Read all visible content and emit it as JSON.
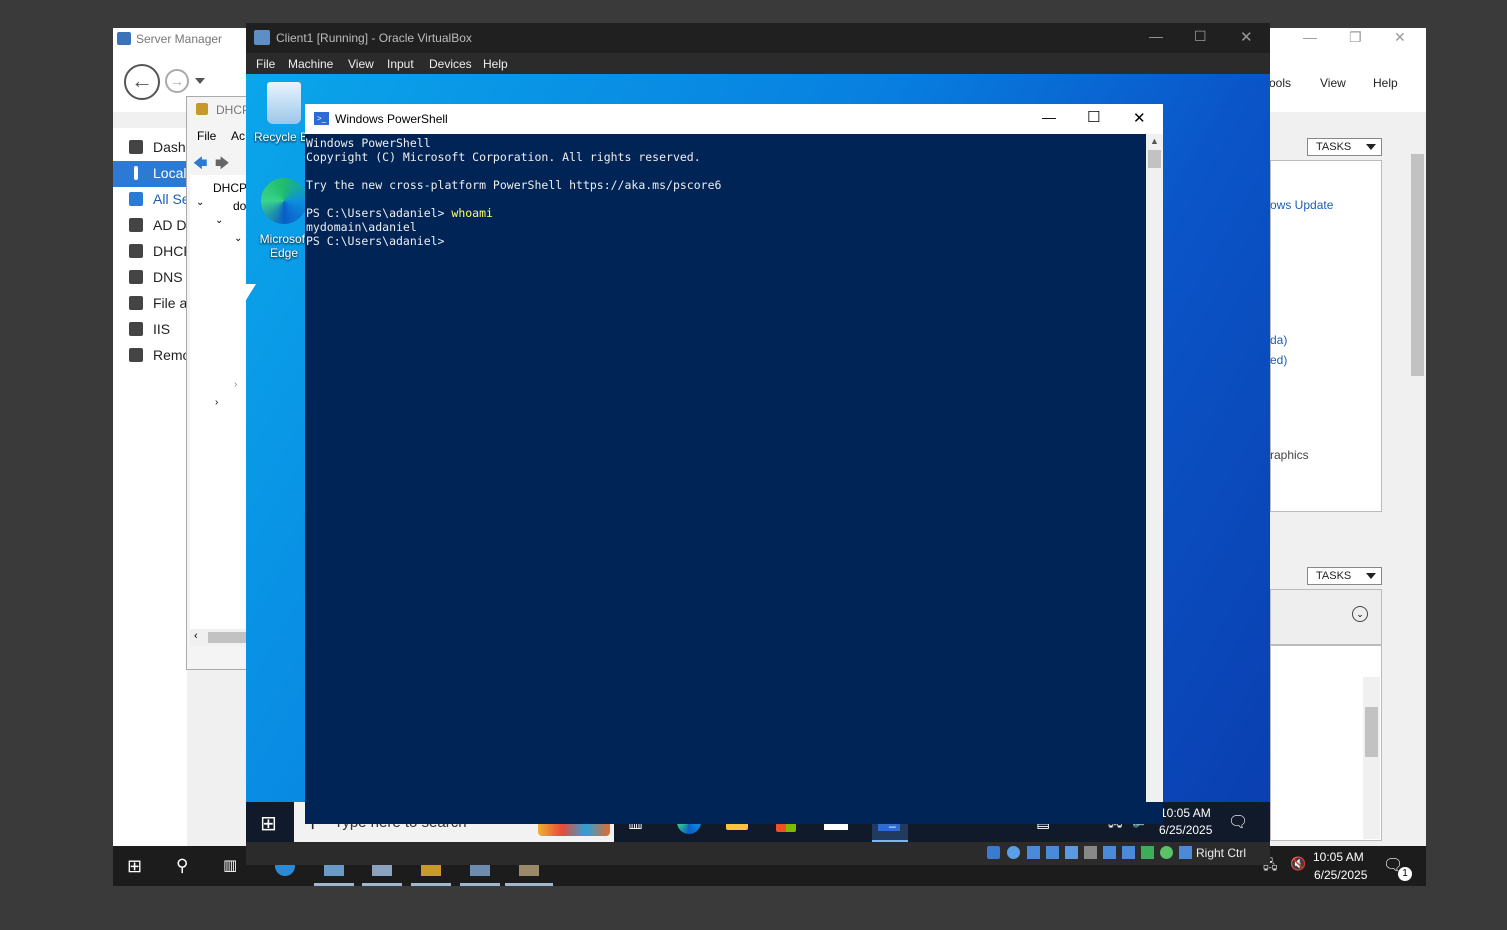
{
  "host": {
    "server_manager": {
      "title": "Server Manager",
      "menu": [
        "Tools",
        "View",
        "Help"
      ],
      "sidebar": [
        {
          "label": "Dashboard",
          "selected": false
        },
        {
          "label": "Local Server",
          "selected": true
        },
        {
          "label": "All Servers",
          "selected": false
        },
        {
          "label": "AD DS",
          "selected": false
        },
        {
          "label": "DHCP",
          "selected": false
        },
        {
          "label": "DNS",
          "selected": false
        },
        {
          "label": "File and Storage Services",
          "selected": false
        },
        {
          "label": "IIS",
          "selected": false
        },
        {
          "label": "Remote Access",
          "selected": false
        }
      ],
      "right": {
        "tasks_label_1": "TASKS",
        "tasks_label_2": "TASKS",
        "links": [
          "ows Update",
          "da)",
          "ed)",
          "raphics"
        ]
      }
    },
    "dhcp_window": {
      "title": "DHCP",
      "menu_file": "File",
      "menu_action": "Ac",
      "tree_root": "DHCP",
      "tree_child": "do"
    },
    "taskbar": {
      "time": "10:05 AM",
      "date": "6/25/2025",
      "notif_count": "1"
    }
  },
  "vbox": {
    "title": "Client1 [Running] - Oracle VirtualBox",
    "menu": [
      "File",
      "Machine",
      "View",
      "Input",
      "Devices",
      "Help"
    ],
    "status_host_key": "Right Ctrl"
  },
  "guest": {
    "desktop_icons": [
      {
        "name": "recycle-bin",
        "label": "Recycle Bin"
      },
      {
        "name": "edge",
        "label_line1": "Microsoft",
        "label_line2": "Edge"
      }
    ],
    "powershell": {
      "title": "Windows PowerShell",
      "lines": [
        {
          "text": "Windows PowerShell"
        },
        {
          "text": "Copyright (C) Microsoft Corporation. All rights reserved."
        },
        {
          "text": ""
        },
        {
          "text": "Try the new cross-platform PowerShell https://aka.ms/pscore6"
        },
        {
          "text": ""
        },
        {
          "prompt": "PS C:\\Users\\adaniel> ",
          "cmd": "whoami"
        },
        {
          "text": "mydomain\\adaniel"
        },
        {
          "prompt": "PS C:\\Users\\adaniel> ",
          "cmd": ""
        }
      ]
    },
    "taskbar": {
      "search_placeholder": "Type here to search",
      "time": "10:05 AM",
      "date": "6/25/2025"
    }
  },
  "colors": {
    "ps_background": "#012456",
    "ps_command": "#ffff66",
    "selection_blue": "#2b7ad3"
  }
}
